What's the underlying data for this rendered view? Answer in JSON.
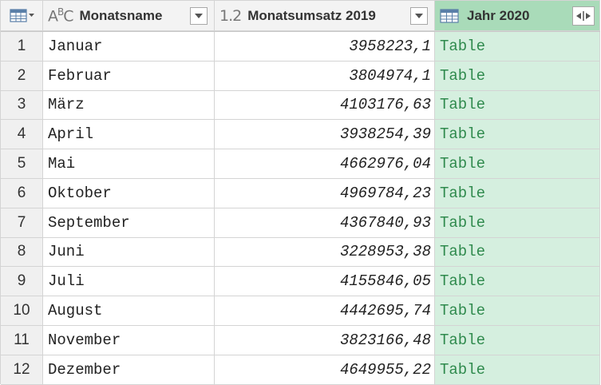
{
  "columns": [
    {
      "type_icon": "ABC",
      "title": "Monatsname"
    },
    {
      "type_icon": "1.2",
      "title": "Monatsumsatz 2019"
    },
    {
      "type_icon": "table-icon",
      "title": "Jahr 2020"
    }
  ],
  "rows": [
    {
      "n": "1",
      "name": "Januar",
      "value": "3958223,1",
      "table": "Table"
    },
    {
      "n": "2",
      "name": "Februar",
      "value": "3804974,1",
      "table": "Table"
    },
    {
      "n": "3",
      "name": "März",
      "value": "4103176,63",
      "table": "Table"
    },
    {
      "n": "4",
      "name": "April",
      "value": "3938254,39",
      "table": "Table"
    },
    {
      "n": "5",
      "name": "Mai",
      "value": "4662976,04",
      "table": "Table"
    },
    {
      "n": "6",
      "name": "Oktober",
      "value": "4969784,23",
      "table": "Table"
    },
    {
      "n": "7",
      "name": "September",
      "value": "4367840,93",
      "table": "Table"
    },
    {
      "n": "8",
      "name": "Juni",
      "value": "3228953,38",
      "table": "Table"
    },
    {
      "n": "9",
      "name": "Juli",
      "value": "4155846,05",
      "table": "Table"
    },
    {
      "n": "10",
      "name": "August",
      "value": "4442695,74",
      "table": "Table"
    },
    {
      "n": "11",
      "name": "November",
      "value": "3823166,48",
      "table": "Table"
    },
    {
      "n": "12",
      "name": "Dezember",
      "value": "4649955,22",
      "table": "Table"
    }
  ],
  "colors": {
    "selected_header": "#a9dbb9",
    "selected_column": "#d5efdf",
    "table_text": "#2f8a4d",
    "header_bg": "#f3f3f3"
  }
}
